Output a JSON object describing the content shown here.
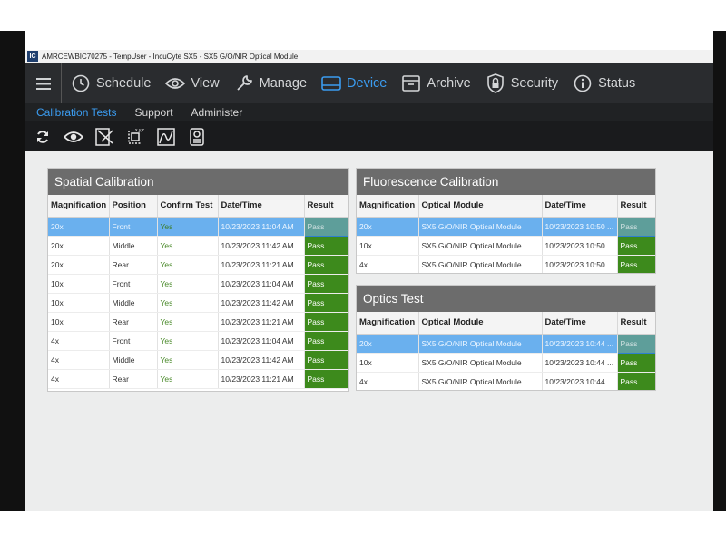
{
  "window": {
    "logo": "IC",
    "title": "AMRCEWBIC70275 - TempUser - IncuCyte SX5 - SX5 G/O/NIR Optical Module"
  },
  "nav": {
    "items": [
      {
        "label": "Schedule",
        "icon": "clock-icon"
      },
      {
        "label": "View",
        "icon": "eye-icon"
      },
      {
        "label": "Manage",
        "icon": "wrench-icon"
      },
      {
        "label": "Device",
        "icon": "device-icon"
      },
      {
        "label": "Archive",
        "icon": "archive-icon"
      },
      {
        "label": "Security",
        "icon": "lock-icon"
      },
      {
        "label": "Status",
        "icon": "info-icon"
      }
    ],
    "active": "Device"
  },
  "subnav": {
    "items": [
      "Calibration Tests",
      "Support",
      "Administer"
    ],
    "active": "Calibration Tests"
  },
  "toolbar": {
    "icons": [
      "refresh-icon",
      "eye-icon",
      "crosshair-image-icon",
      "xyz-axis-icon",
      "curve-graph-icon",
      "device-module-icon"
    ]
  },
  "spatial": {
    "title": "Spatial Calibration",
    "headers": [
      "Magnification",
      "Position",
      "Confirm Test",
      "Date/Time",
      "Result"
    ],
    "rows": [
      [
        "20x",
        "Front",
        "Yes",
        "10/23/2023 11:04 AM",
        "Pass"
      ],
      [
        "20x",
        "Middle",
        "Yes",
        "10/23/2023 11:42 AM",
        "Pass"
      ],
      [
        "20x",
        "Rear",
        "Yes",
        "10/23/2023 11:21 AM",
        "Pass"
      ],
      [
        "10x",
        "Front",
        "Yes",
        "10/23/2023 11:04 AM",
        "Pass"
      ],
      [
        "10x",
        "Middle",
        "Yes",
        "10/23/2023 11:42 AM",
        "Pass"
      ],
      [
        "10x",
        "Rear",
        "Yes",
        "10/23/2023 11:21 AM",
        "Pass"
      ],
      [
        "4x",
        "Front",
        "Yes",
        "10/23/2023 11:04 AM",
        "Pass"
      ],
      [
        "4x",
        "Middle",
        "Yes",
        "10/23/2023 11:42 AM",
        "Pass"
      ],
      [
        "4x",
        "Rear",
        "Yes",
        "10/23/2023 11:21 AM",
        "Pass"
      ]
    ]
  },
  "fluorescence": {
    "title": "Fluorescence Calibration",
    "headers": [
      "Magnification",
      "Optical Module",
      "Date/Time",
      "Result"
    ],
    "rows": [
      [
        "20x",
        "SX5 G/O/NIR Optical Module",
        "10/23/2023 10:50 ...",
        "Pass"
      ],
      [
        "10x",
        "SX5 G/O/NIR Optical Module",
        "10/23/2023 10:50 ...",
        "Pass"
      ],
      [
        "4x",
        "SX5 G/O/NIR Optical Module",
        "10/23/2023 10:50 ...",
        "Pass"
      ]
    ]
  },
  "optics": {
    "title": "Optics Test",
    "headers": [
      "Magnification",
      "Optical Module",
      "Date/Time",
      "Result"
    ],
    "rows": [
      [
        "20x",
        "SX5 G/O/NIR Optical Module",
        "10/23/2023 10:44 ...",
        "Pass"
      ],
      [
        "10x",
        "SX5 G/O/NIR Optical Module",
        "10/23/2023 10:44 ...",
        "Pass"
      ],
      [
        "4x",
        "SX5 G/O/NIR Optical Module",
        "10/23/2023 10:44 ...",
        "Pass"
      ]
    ]
  },
  "colors": {
    "nav_bg": "#2a2c2f",
    "accent": "#3b9cf0",
    "pass_green": "#3d8a1c",
    "selected_row": "#6ab0ee",
    "panel_header": "#6c6c6c"
  }
}
